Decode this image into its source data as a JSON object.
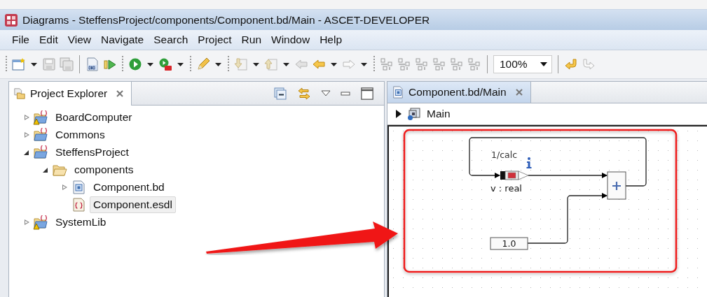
{
  "window": {
    "title": "Diagrams - SteffensProject/components/Component.bd/Main - ASCET-DEVELOPER"
  },
  "menu": [
    "File",
    "Edit",
    "View",
    "Navigate",
    "Search",
    "Project",
    "Run",
    "Window",
    "Help"
  ],
  "toolbar": {
    "zoom": "100%"
  },
  "project_explorer": {
    "title": "Project Explorer",
    "tree": [
      {
        "label": "BoardComputer",
        "kind": "project",
        "expanded": false,
        "warning": true,
        "selected": false
      },
      {
        "label": "Commons",
        "kind": "project",
        "expanded": false,
        "warning": false,
        "selected": false
      },
      {
        "label": "SteffensProject",
        "kind": "project",
        "expanded": true,
        "warning": false,
        "selected": false,
        "children": [
          {
            "label": "components",
            "kind": "folder",
            "expanded": true,
            "warning": false,
            "selected": false,
            "children": [
              {
                "label": "Component.bd",
                "kind": "bd",
                "expanded": false,
                "warning": false,
                "selected": false
              },
              {
                "label": "Component.esdl",
                "kind": "esdl",
                "warning": false,
                "selected": true
              }
            ]
          }
        ]
      },
      {
        "label": "SystemLib",
        "kind": "project",
        "expanded": false,
        "warning": true,
        "selected": false
      }
    ]
  },
  "editor": {
    "tab": "Component.bd/Main",
    "breadcrumb": "Main",
    "diagram": {
      "annotation": "1/calc",
      "variable": "v : real",
      "constant": "1.0"
    }
  }
}
